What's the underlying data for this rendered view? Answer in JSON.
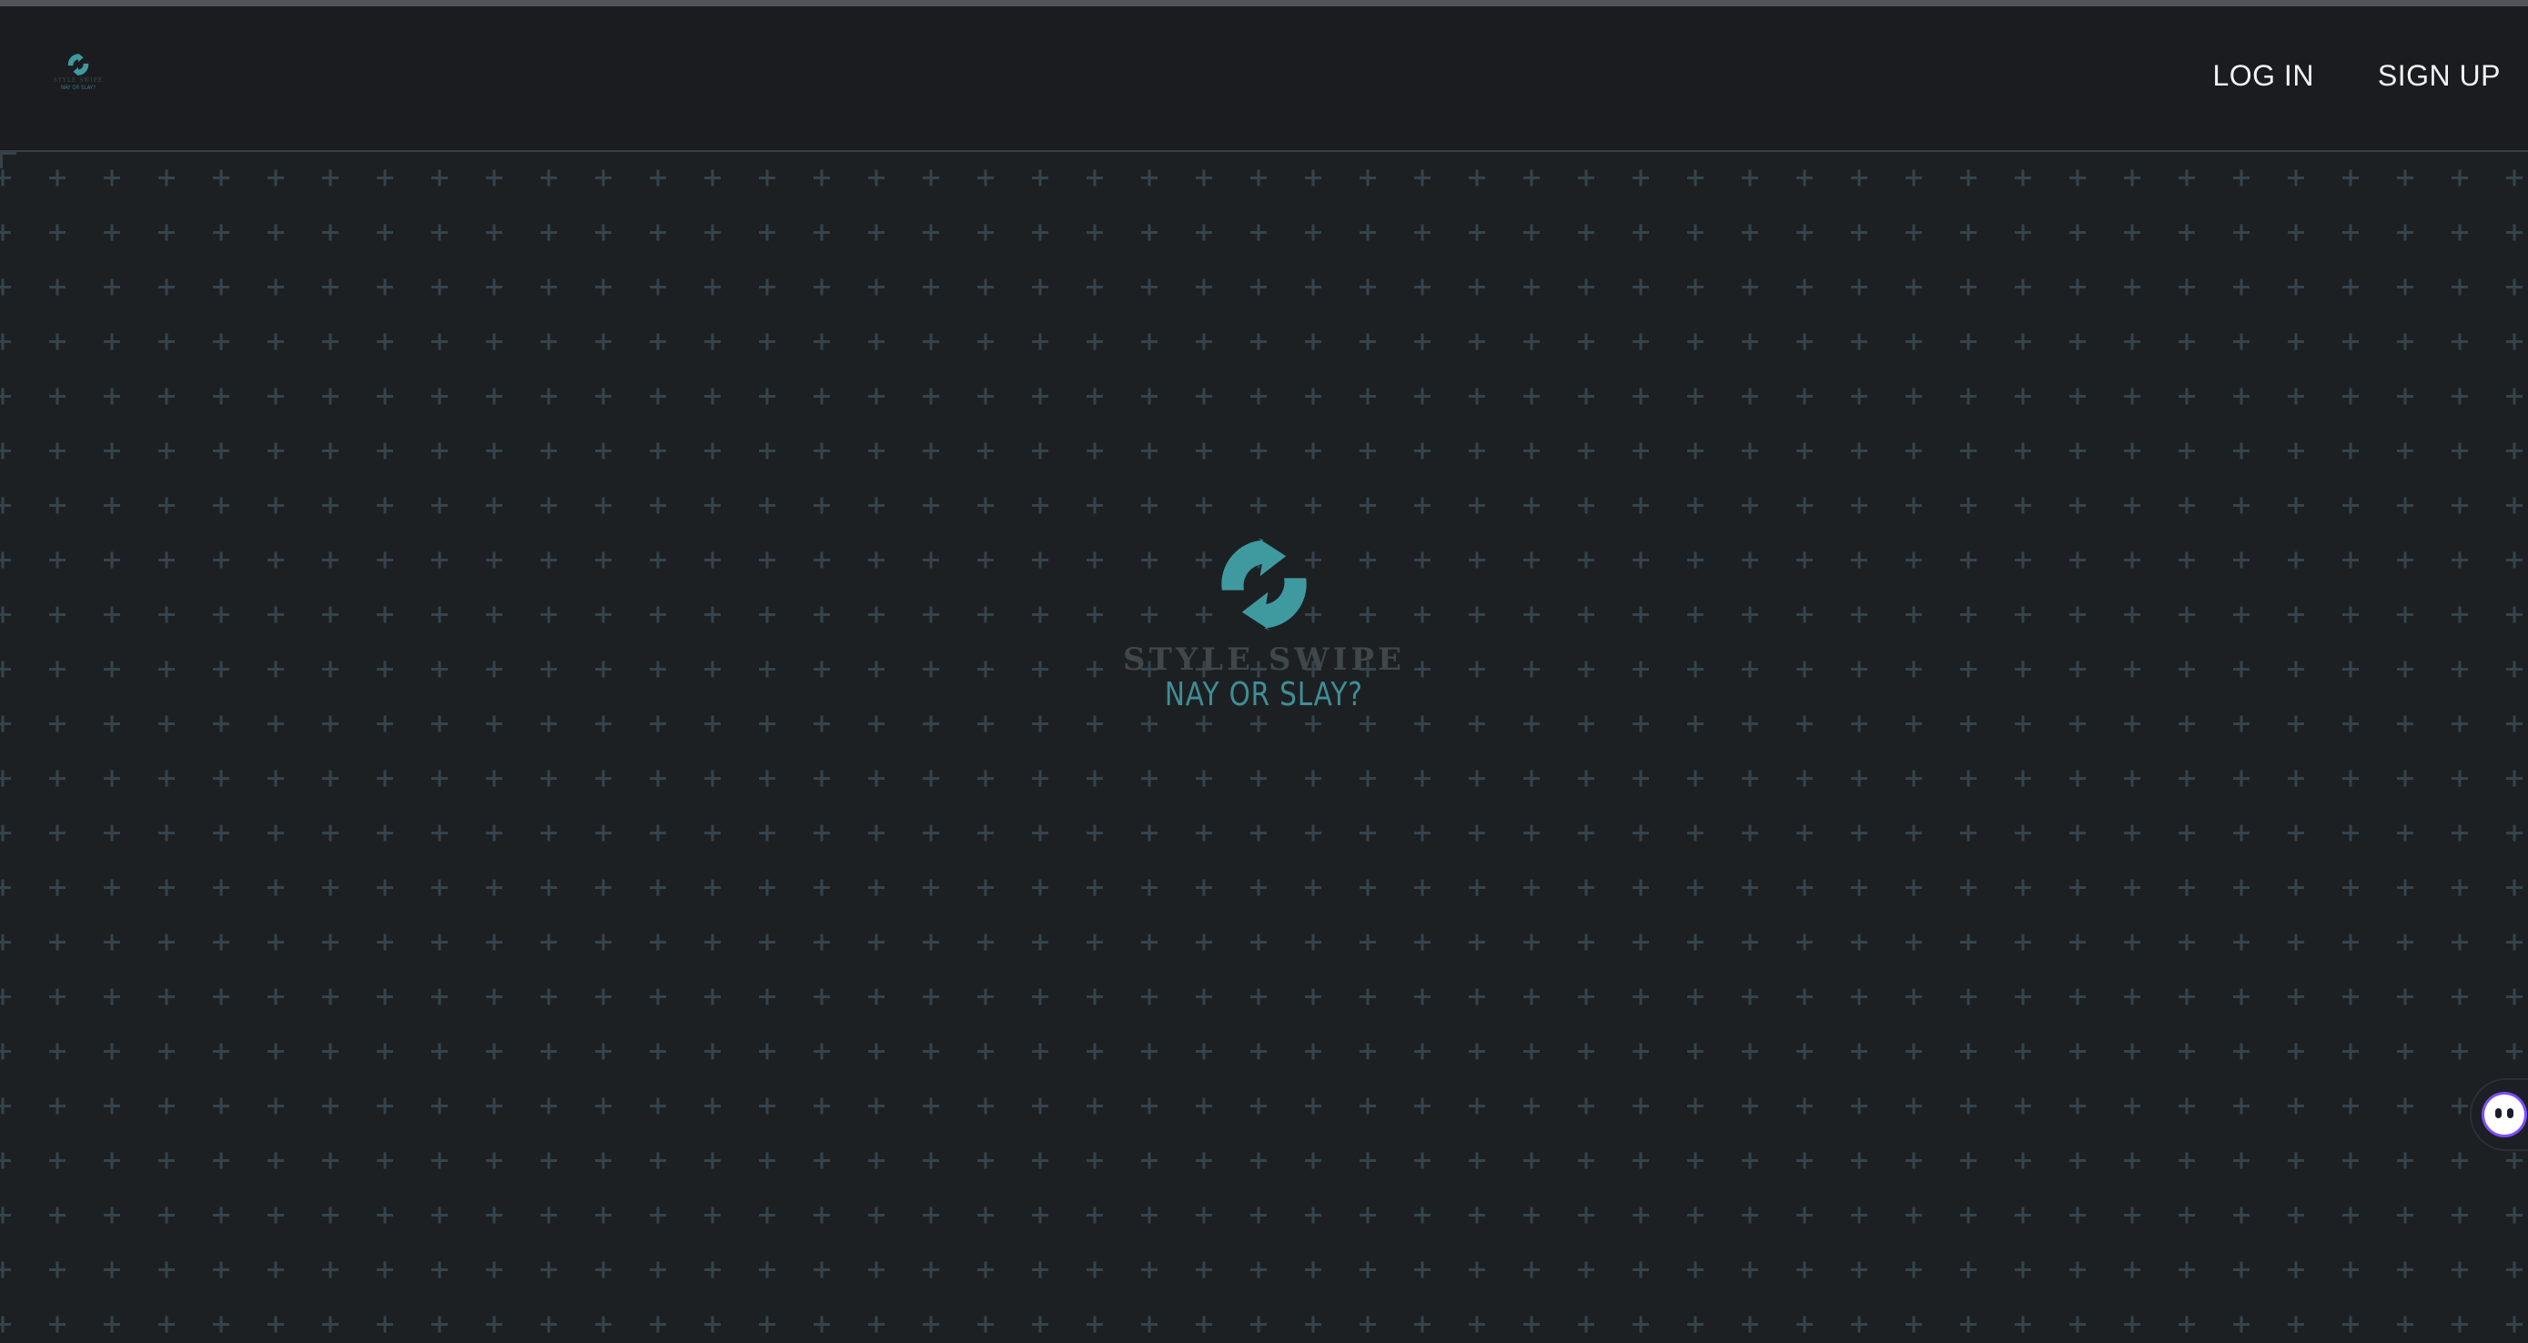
{
  "brand": {
    "name": "STYLE SWIPE",
    "tagline": "NAY OR SLAY?",
    "accent_color": "#3f9aa0",
    "logo_icon": "swipe-arrows-icon"
  },
  "nav": {
    "login_label": "LOG IN",
    "signup_label": "SIGN UP"
  },
  "chat_widget": {
    "icon": "chat-bot-face-icon",
    "accent_color": "#7c4dff"
  }
}
